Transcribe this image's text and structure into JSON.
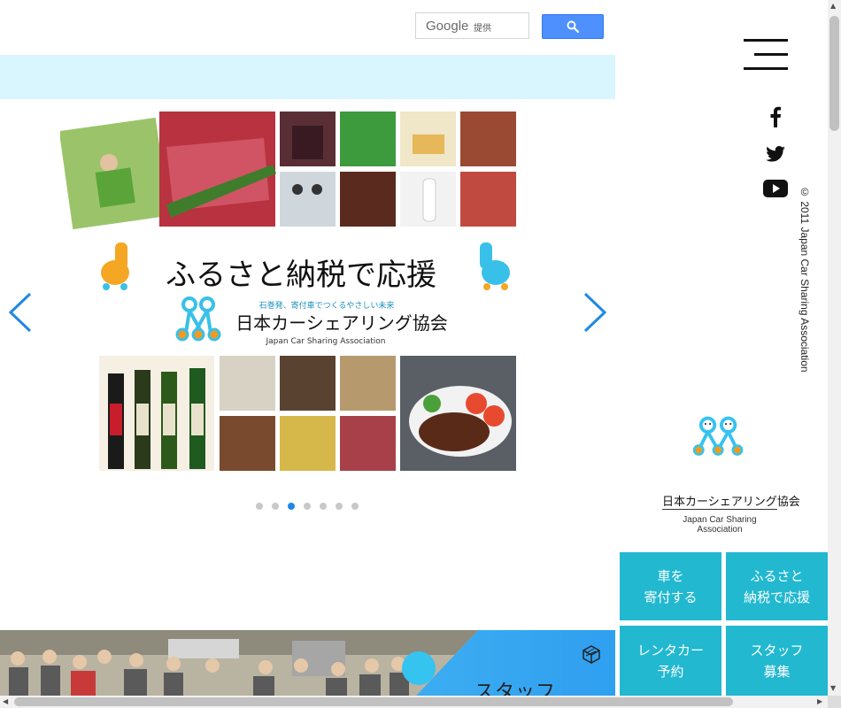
{
  "search": {
    "brand": "Google",
    "provided_by": "提供",
    "button_icon": "search-icon"
  },
  "slider": {
    "tagline": "ふるさと納税で応援",
    "slogan": "石巻発、寄付車でつくるやさしい未来",
    "org_jp": "日本カーシェアリング協会",
    "org_en": "Japan Car Sharing Association",
    "products_top": [
      "wagyu beef",
      "jam jar",
      "greens",
      "butter",
      "grilled meat",
      "staff",
      "steak",
      "bottle",
      "sashimi"
    ],
    "products_bottom": [
      "sake",
      "七田",
      "能代",
      "万齢",
      "cards",
      "gift box",
      "lotus root",
      "hamburg steak",
      "rice",
      "meat",
      "steak plate"
    ],
    "dots_count": 7,
    "active_dot": 2
  },
  "banner": {
    "title": "スタッフ"
  },
  "social": [
    "facebook-icon",
    "twitter-icon",
    "youtube-icon"
  ],
  "copyright": "© 2011 Japan Car Sharing Association",
  "logo": {
    "jp": "日本カーシェアリング協会",
    "en_line1": "Japan Car Sharing",
    "en_line2": "Association"
  },
  "tiles": [
    {
      "label": "車を\n寄付する"
    },
    {
      "label": "ふるさと\n納税で応援"
    },
    {
      "label": "レンタカー\n予約"
    },
    {
      "label": "スタッフ\n募集"
    }
  ],
  "colors": {
    "accent_teal": "#21b8d0",
    "logo_blue": "#35c3f0",
    "logo_orange": "#f29a1f",
    "info_bar": "#d9f5fd",
    "slider_arrow": "#1e88e5"
  }
}
